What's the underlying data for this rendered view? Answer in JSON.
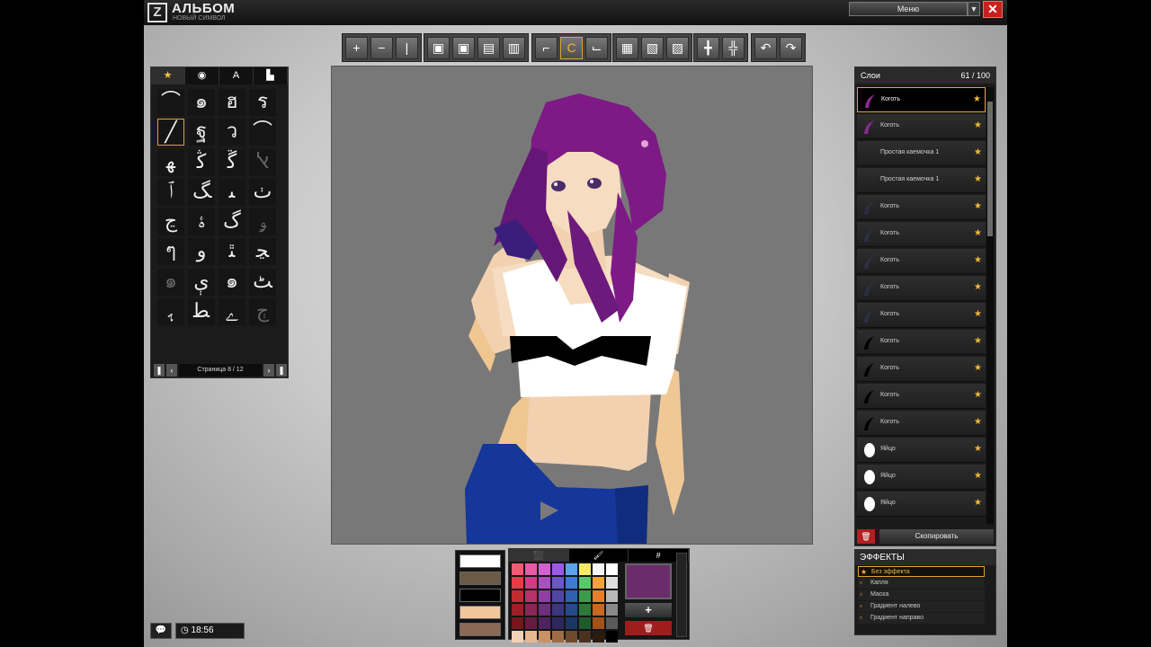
{
  "app": {
    "title": "АЛЬБОМ",
    "subtitle": "НОВЫЙ СИМВОЛ",
    "logo_letter": "Z",
    "menu_label": "Меню",
    "menu_arrow": "▼",
    "close": "✕"
  },
  "toolbar": {
    "groups": [
      [
        "zoom-in-icon",
        "zoom-out-icon",
        "fit-icon"
      ],
      [
        "layer-front-icon",
        "layer-back-icon",
        "layer-up-icon",
        "layer-down-icon"
      ],
      [
        "curve-tool-icon",
        "color-tool-icon",
        "shape-tool-icon"
      ],
      [
        "flip-h-icon",
        "flip-v-icon",
        "mirror-icon"
      ],
      [
        "move-h-icon",
        "move-v-icon"
      ],
      [
        "undo-icon",
        "redo-icon"
      ]
    ],
    "glyphs": [
      [
        "+",
        "−",
        "|"
      ],
      [
        "▣",
        "▣",
        "▤",
        "▥"
      ],
      [
        "⌐",
        "C",
        "⌙"
      ],
      [
        "▦",
        "▧",
        "▨"
      ],
      [
        "╋",
        "╬"
      ],
      [
        "↶",
        "↷"
      ]
    ],
    "active": "color-tool-icon"
  },
  "brushes": {
    "tabs": [
      "★",
      "◉",
      "A",
      "▙"
    ],
    "active_tab": 0,
    "cells": [
      "⌒",
      "๑",
      "ฮ",
      "ร",
      "╱",
      "ฐ",
      "ว",
      "⌒",
      "ﻬ",
      "ﯕ",
      "ﮜ",
      "ﭏ",
      "ﭐ",
      "ﮓ",
      "ﯩ",
      "ﭞ",
      "ﭶ",
      "ﮤ",
      "ﮒ",
      "ﯡ",
      "ๆ",
      "ﻭ",
      "ﭥ",
      "ﭹ",
      "๑",
      "ﯤ",
      "๑",
      "ﭧ",
      "ﮨ",
      "ﻄ",
      "ﮮ",
      "ﭲ"
    ],
    "selected_index": 4,
    "page_label": "Страница 8 / 12"
  },
  "layers": {
    "title": "Слои",
    "count": "61 / 100",
    "items": [
      {
        "name": "Коготь",
        "thumb": "claw-purple"
      },
      {
        "name": "Коготь",
        "thumb": "claw-purple"
      },
      {
        "name": "Простая каемочка 1",
        "thumb": "blank"
      },
      {
        "name": "Простая каемочка 1",
        "thumb": "blank"
      },
      {
        "name": "Коготь",
        "thumb": "claw-dark"
      },
      {
        "name": "Коготь",
        "thumb": "claw-dark"
      },
      {
        "name": "Коготь",
        "thumb": "claw-dark"
      },
      {
        "name": "Коготь",
        "thumb": "claw-dark"
      },
      {
        "name": "Коготь",
        "thumb": "claw-dark"
      },
      {
        "name": "Коготь",
        "thumb": "claw-black"
      },
      {
        "name": "Коготь",
        "thumb": "claw-black"
      },
      {
        "name": "Коготь",
        "thumb": "claw-black"
      },
      {
        "name": "Коготь",
        "thumb": "claw-black"
      },
      {
        "name": "Яйцо",
        "thumb": "egg"
      },
      {
        "name": "Яйцо",
        "thumb": "egg"
      },
      {
        "name": "Яйцо",
        "thumb": "egg"
      }
    ],
    "selected_index": 0,
    "delete_label": "🗑",
    "copy_label": "Скопировать"
  },
  "effects": {
    "title": "ЭФФЕКТЫ",
    "items": [
      "Без эффекта",
      "Капля",
      "Маска",
      "Градиент налево",
      "Градиент направо"
    ],
    "selected_index": 0
  },
  "swatch_stack": [
    "#ffffff",
    "#6b5a46",
    "#000000",
    "#f2c69b",
    "#8a6a56"
  ],
  "palette": {
    "tabs": [
      "⬛",
      "🖌",
      "#"
    ],
    "active_tab": 0,
    "colors": [
      "#f25a74",
      "#e65aa8",
      "#cf62d0",
      "#9a5be3",
      "#5aa3e8",
      "#f7e86a",
      "#f7f7f7",
      "#ffffff",
      "#e73b46",
      "#d63a86",
      "#a950c0",
      "#6b56c8",
      "#3f78d6",
      "#5ac76a",
      "#f4a23c",
      "#dedede",
      "#c42a31",
      "#b8326a",
      "#8e3fa3",
      "#5245a2",
      "#2f60b0",
      "#3a9b4d",
      "#e47f2a",
      "#b8b8b8",
      "#9c2025",
      "#8a2655",
      "#6b2f7e",
      "#3e357e",
      "#244a8a",
      "#2b7a3b",
      "#c9681f",
      "#8a8a8a",
      "#74161c",
      "#661c40",
      "#4e2260",
      "#2d275d",
      "#1a3566",
      "#1f5a2b",
      "#a35216",
      "#5a5a5a",
      "#f3d3b6",
      "#e6b892",
      "#c89166",
      "#9d6c45",
      "#6f4a2d",
      "#4a3120",
      "#2b1c12",
      "#000000"
    ],
    "current": "#6b2c6c",
    "add_label": "+",
    "delete_label": "🗑"
  },
  "status": {
    "chat_icon": "💬",
    "clock_icon": "◷",
    "time": "18:56"
  }
}
